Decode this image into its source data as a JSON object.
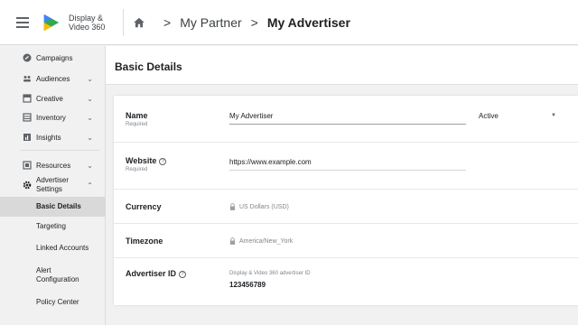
{
  "app": {
    "logo_line1": "Display &",
    "logo_line2": "Video 360",
    "brand_colors": {
      "blue": "#4285f4",
      "green": "#34a853",
      "yellow": "#fbbc04"
    }
  },
  "breadcrumb": {
    "items": [
      {
        "label": "My Partner"
      },
      {
        "label": "My Advertiser"
      }
    ],
    "separator": ">"
  },
  "sidebar": {
    "items": [
      {
        "label": "Campaigns",
        "icon": "campaigns-icon",
        "chevron": ""
      },
      {
        "label": "Audiences",
        "icon": "audiences-icon",
        "chevron": "⌄"
      },
      {
        "label": "Creative",
        "icon": "creative-icon",
        "chevron": "⌄"
      },
      {
        "label": "Inventory",
        "icon": "inventory-icon",
        "chevron": "⌄"
      },
      {
        "label": "Insights",
        "icon": "insights-icon",
        "chevron": "⌄"
      },
      {
        "label": "Resources",
        "icon": "resources-icon",
        "chevron": "⌄"
      },
      {
        "label": "Advertiser Settings",
        "icon": "settings-gear-icon",
        "chevron": "⌃"
      }
    ],
    "subitems": [
      {
        "label": "Basic Details",
        "active": true
      },
      {
        "label": "Targeting",
        "active": false
      },
      {
        "label": "Linked Accounts",
        "active": false
      },
      {
        "label": "Alert Configuration",
        "active": false
      },
      {
        "label": "Policy Center",
        "active": false
      }
    ]
  },
  "page": {
    "title": "Basic Details"
  },
  "form": {
    "name": {
      "label": "Name",
      "sublabel": "Required",
      "value": "My Advertiser",
      "status": "Active"
    },
    "website": {
      "label": "Website",
      "sublabel": "Required",
      "value": "https://www.example.com"
    },
    "currency": {
      "label": "Currency",
      "value": "US Dollars (USD)"
    },
    "timezone": {
      "label": "Timezone",
      "value": "America/New_York"
    },
    "advertiser_id": {
      "label": "Advertiser ID",
      "caption": "Display & Video 360 advertiser ID",
      "value": "123456789"
    }
  }
}
